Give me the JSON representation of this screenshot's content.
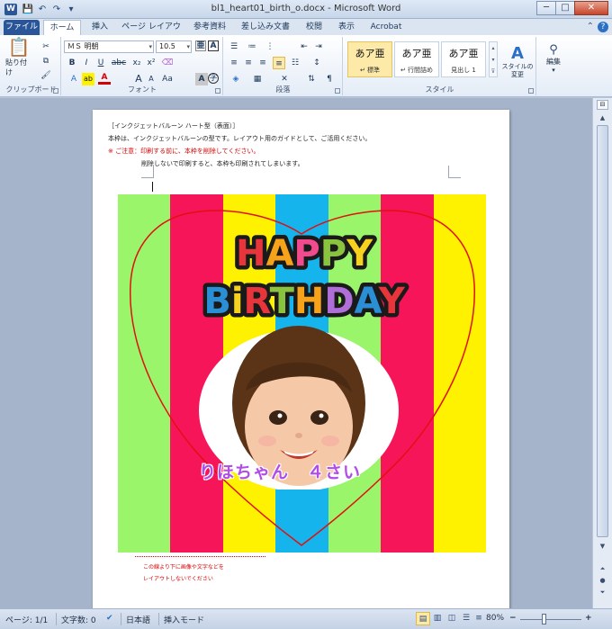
{
  "window": {
    "title": "bl1_heart01_birth_o.docx - Microsoft Word",
    "app_icon": "W",
    "controls": {
      "minimize": "─",
      "maximize": "□",
      "close": "✕"
    }
  },
  "quick_access": {
    "save": "💾",
    "undo": "↶",
    "redo": "↷",
    "customize": "▾"
  },
  "tabs": {
    "file": "ファイル",
    "home": "ホーム",
    "insert": "挿入",
    "page_layout": "ページ レイアウト",
    "references": "参考資料",
    "mailings": "差し込み文書",
    "review": "校閲",
    "view": "表示",
    "acrobat": "Acrobat"
  },
  "ribbon": {
    "clipboard": {
      "label": "クリップボード",
      "paste_label": "貼り付け"
    },
    "font": {
      "label": "フォント",
      "font_name": "ＭＳ 明朝",
      "font_size": "10.5",
      "bold": "B",
      "italic": "I",
      "underline": "U",
      "strike": "abc",
      "subscript": "x₂",
      "superscript": "x²",
      "grow": "A",
      "shrink": "A",
      "font_color": "A",
      "highlight": "ab"
    },
    "paragraph": {
      "label": "段落"
    },
    "styles": {
      "label": "スタイル",
      "items": [
        {
          "sample": "あア亜",
          "name": "↵ 標準"
        },
        {
          "sample": "あア亜",
          "name": "↵ 行間詰め"
        },
        {
          "sample": "あア亜",
          "name": "見出し 1"
        }
      ],
      "change_styles": "スタイルの\n変更"
    },
    "editing": {
      "label": "編集"
    }
  },
  "document": {
    "lines": [
      "［インクジェットバルーン ハート型（表面）］",
      "本枠は、インクジェットバルーンの型です。レイアウト用のガイドとして、ご活用ください。",
      "※ ご注意：印刷する前に、本枠を削除してください。",
      "削除しないで印刷すると、本枠も印刷されてしまいます。"
    ],
    "art_text": {
      "happy": "HAPPY",
      "birthday": "BiRTHDAY",
      "name": "りほちゃん　４さい"
    },
    "bottom_note": [
      "この線より下に画像や文字などを",
      "レイアウトしないでください"
    ],
    "colors": {
      "stripes": [
        "#9af56a",
        "#f7155a",
        "#fff200",
        "#16b4ec",
        "#9af56a",
        "#f7155a",
        "#fff200"
      ],
      "heart_outline": "#e01010",
      "warning_text": "#d40000",
      "name_text": "#b24ce8"
    }
  },
  "status_bar": {
    "page": "ページ: 1/1",
    "words": "文字数: 0",
    "language": "日本語",
    "mode": "挿入モード",
    "zoom": "80%",
    "zoom_out": "−",
    "zoom_in": "+"
  }
}
